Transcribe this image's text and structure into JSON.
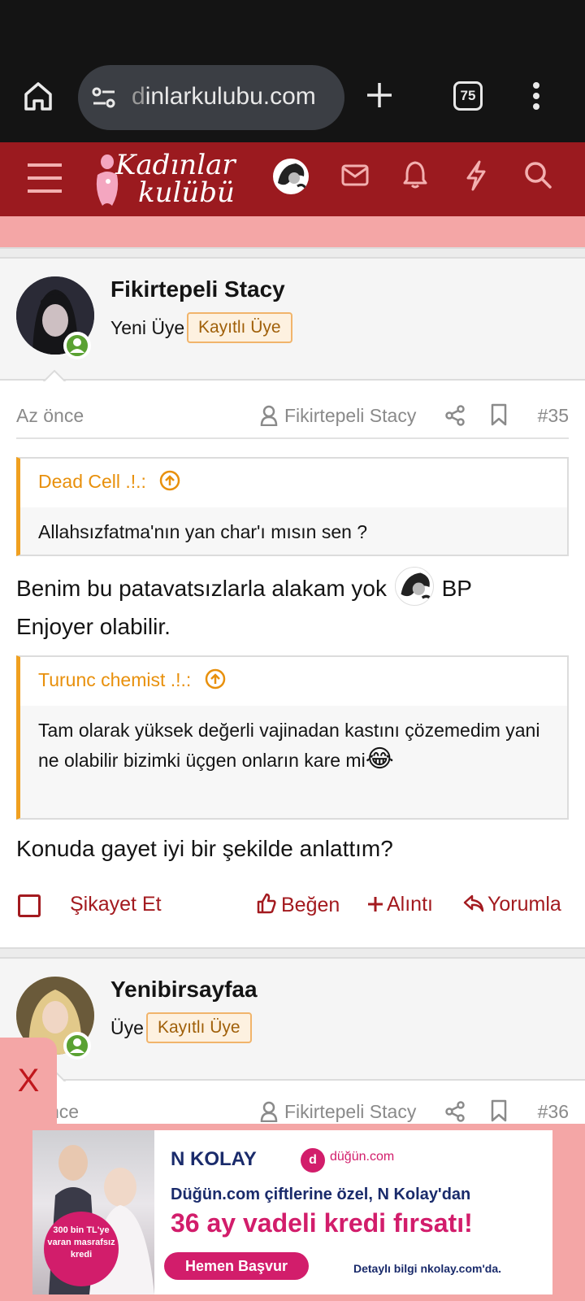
{
  "browser": {
    "url_faded": "d",
    "url_text": "inlarkulubu.com",
    "tab_count": "75"
  },
  "site": {
    "logo_line1": "Kadınlar",
    "logo_line2": "kulübü",
    "colors": {
      "header": "#9b1a1f",
      "accent": "#a31a1f",
      "quote_accent": "#f0a020",
      "online": "#5aa132"
    }
  },
  "posts": [
    {
      "username": "Fikirtepeli Stacy",
      "user_title": "Yeni Üye",
      "badge": "Kayıtlı Üye",
      "time": "Az önce",
      "author": "Fikirtepeli Stacy",
      "number": "#35",
      "quote1": {
        "author": "Dead Cell .!.:",
        "text": "Allahsızfatma'nın yan char'ı mısın sen ?"
      },
      "body1_part1": "Benim bu patavatsızlarla alakam yok",
      "body1_part2": "BP",
      "body1_part3": "Enjoyer olabilir.",
      "quote2": {
        "author": "Turunc chemist .!.:",
        "text": "Tam olarak yüksek değerli vajinadan kastını çözemedim yani ne olabilir bizimki üçgen onların kare mi"
      },
      "quote2_emoji": "😂",
      "body2": "Konuda gayet iyi bir şekilde anlattım?",
      "actions": {
        "report": "Şikayet Et",
        "like": "Beğen",
        "quote": "Alıntı",
        "reply": "Yorumla"
      }
    },
    {
      "username": "Yenibirsayfaa",
      "user_title": "Üye",
      "badge": "Kayıtlı Üye",
      "time_partial": "nce",
      "author": "Fikirtepeli Stacy",
      "number": "#36"
    }
  ],
  "ad": {
    "close": "X",
    "brand1": "N KOLAY",
    "brand2": "düğün.com",
    "line1": "Düğün.com çiftlerine özel, N Kolay'dan",
    "line2": "36 ay vadeli kredi fırsatı!",
    "button": "Hemen Başvur",
    "detail": "Detaylı bilgi nkolay.com'da.",
    "circle": "300 bin TL'ye varan masrafsız kredi"
  }
}
